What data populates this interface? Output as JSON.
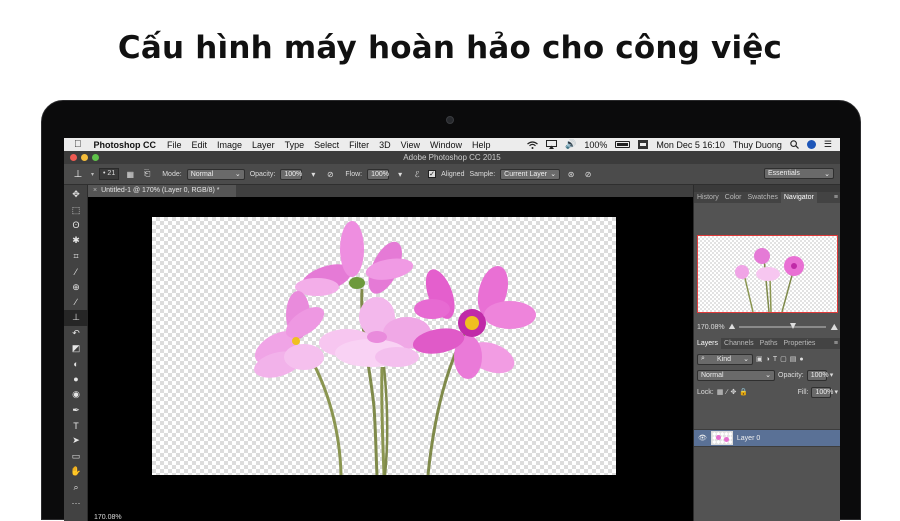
{
  "headline": "Cấu hình máy hoàn hảo cho công việc",
  "menubar": {
    "apple": "",
    "app_name": "Photoshop CC",
    "items": [
      "File",
      "Edit",
      "Image",
      "Layer",
      "Type",
      "Select",
      "Filter",
      "3D",
      "View",
      "Window",
      "Help"
    ],
    "wifi": "wifi-icon",
    "airplay": "airplay-icon",
    "volume": "🔊",
    "battery_percent": "100%",
    "datetime": "Mon Dec 5  16:10",
    "user": "Thuy Duong"
  },
  "titlebar": {
    "title": "Adobe Photoshop CC 2015"
  },
  "options": {
    "brush_size": "21",
    "mode_label": "Mode:",
    "mode_value": "Normal",
    "opacity_label": "Opacity:",
    "opacity_value": "100%",
    "flow_label": "Flow:",
    "flow_value": "100%",
    "aligned_label": "Aligned",
    "sample_label": "Sample:",
    "sample_value": "Current Layer",
    "workspace": "Essentials"
  },
  "document": {
    "tab_title": "Untitled-1 @ 170% (Layer 0, RGB/8) *",
    "zoom": "170.08%"
  },
  "panels": {
    "top_tabs": [
      "History",
      "Color",
      "Swatches",
      "Navigator"
    ],
    "navigator_zoom": "170.08%",
    "layer_tabs": [
      "Layers",
      "Channels",
      "Paths",
      "Properties"
    ],
    "kind_label": "Kind",
    "blend_mode": "Normal",
    "opacity_label": "Opacity:",
    "opacity_value": "100%",
    "lock_label": "Lock:",
    "fill_label": "Fill:",
    "fill_value": "100%",
    "layer_name": "Layer 0"
  },
  "colors": {
    "flower_pink": "#e57ad6",
    "flower_center": "#f0c020",
    "stem": "#7f8a4a",
    "selected_layer": "#5a7196"
  }
}
